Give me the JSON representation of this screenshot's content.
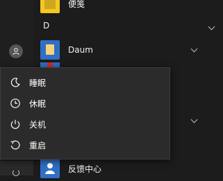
{
  "start_menu": {
    "apps": [
      {
        "label": "便笺",
        "tile_color": "#3a3a3a"
      },
      {
        "label": "Daum",
        "tile_color": "#2f6fc6"
      },
      {
        "label": "反馈中心",
        "tile_color": "#2f6fc6"
      }
    ],
    "section_letter": "D"
  },
  "power_menu": {
    "items": [
      {
        "label": "睡眠",
        "icon": "moon-icon"
      },
      {
        "label": "休眠",
        "icon": "clock-icon"
      },
      {
        "label": "关机",
        "icon": "power-icon"
      },
      {
        "label": "重启",
        "icon": "restart-icon"
      }
    ]
  },
  "colors": {
    "background": "#1c1c1c",
    "menu_background": "#2b2b2b",
    "tile_blue": "#2f6fc6",
    "note_yellow": "#f6c621"
  }
}
